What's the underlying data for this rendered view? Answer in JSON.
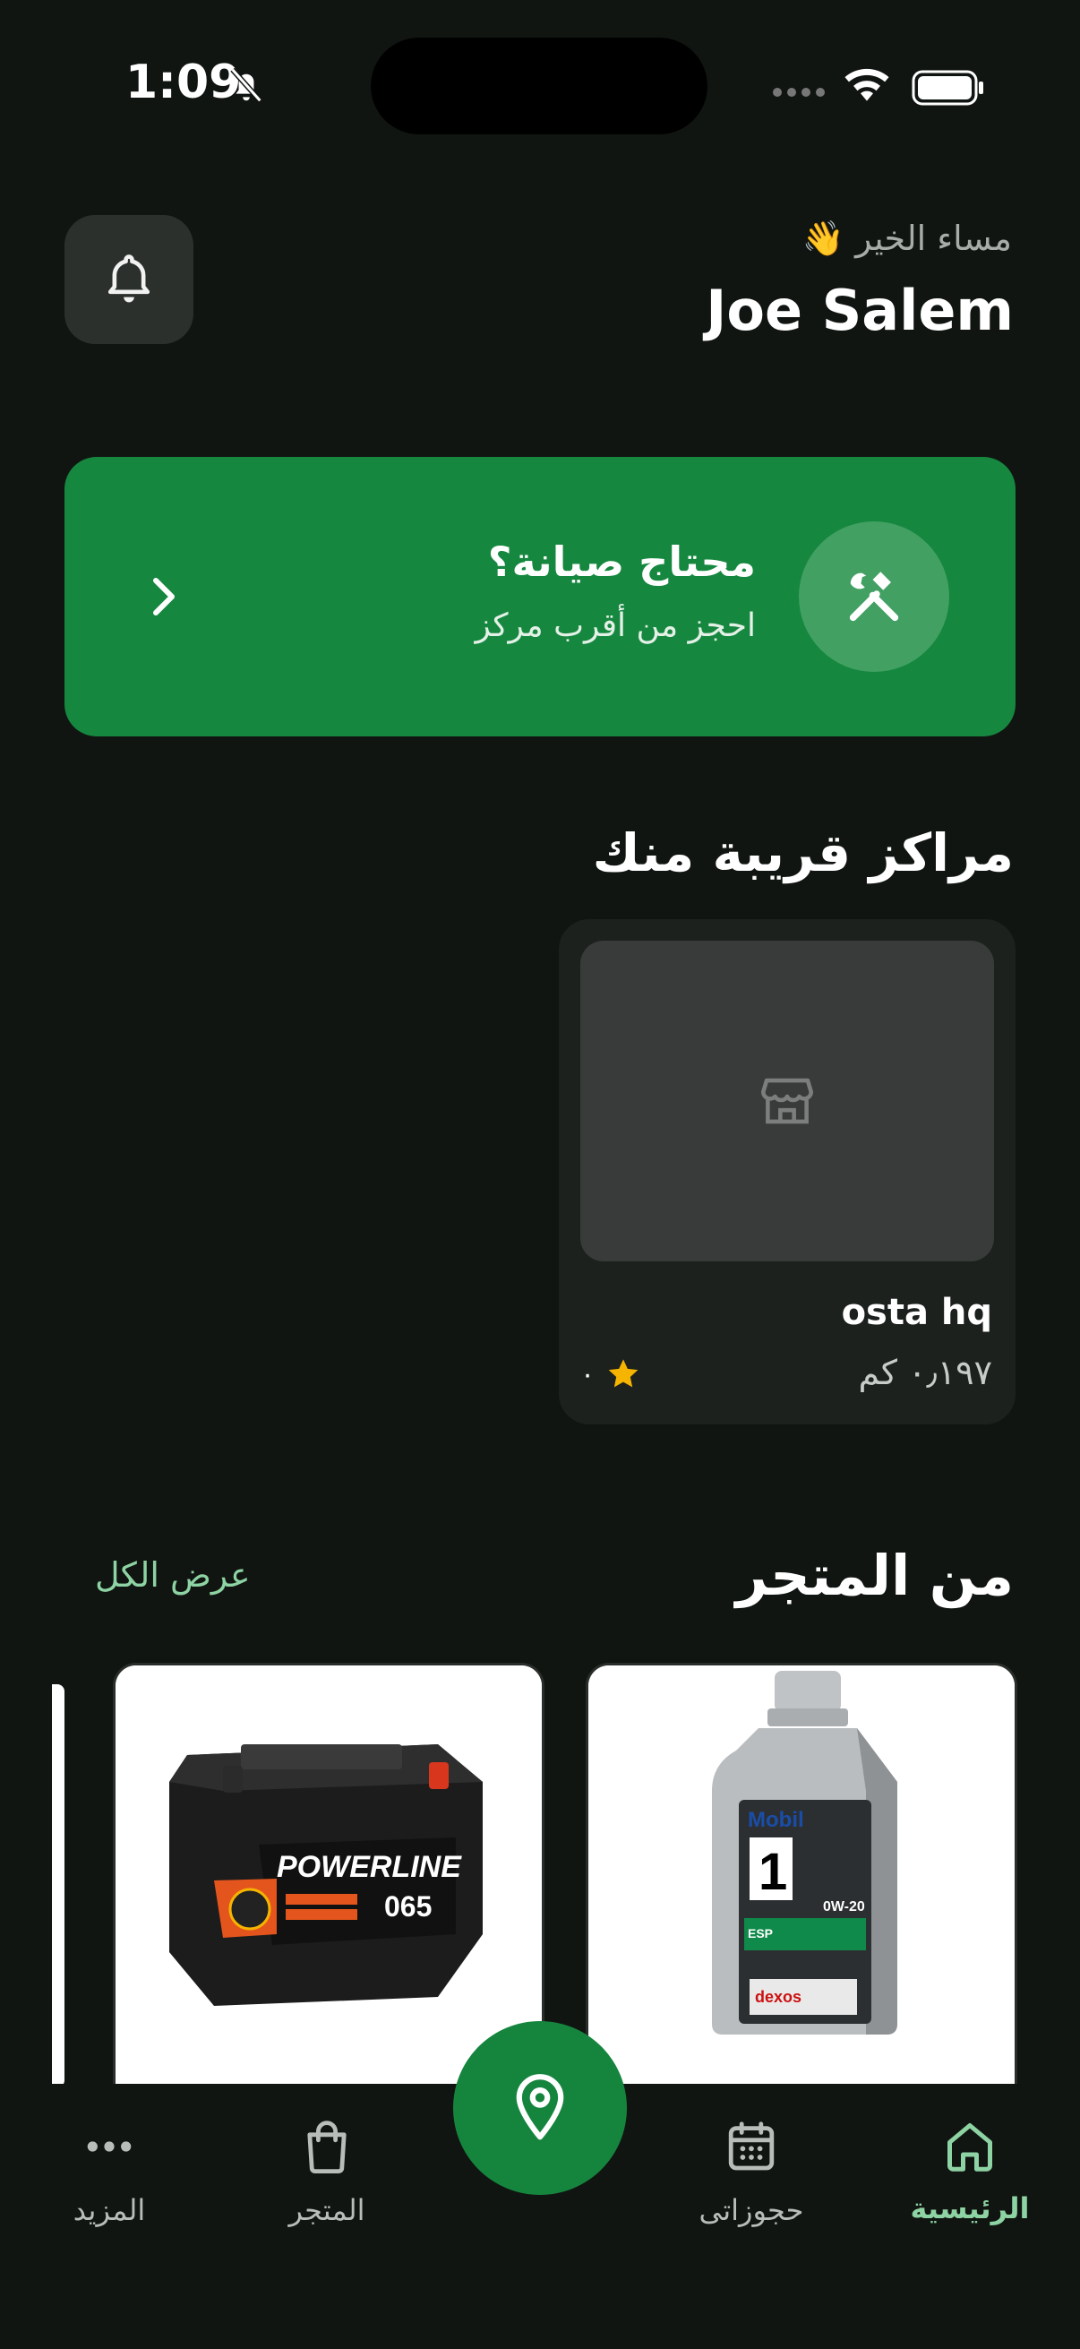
{
  "status_bar": {
    "time": "1:09"
  },
  "header": {
    "greeting": "مساء الخير 👋",
    "username": "Joe Salem"
  },
  "service_banner": {
    "title": "محتاج صيانة؟",
    "subtitle": "احجز من أقرب مركز"
  },
  "nearby": {
    "title": "مراكز قريبة منك",
    "centers": [
      {
        "name": "osta hq",
        "distance": "٠٫١٩٧ كم",
        "rating": "٠"
      }
    ]
  },
  "store": {
    "title": "من المتجر",
    "view_all": "عرض الكل",
    "products": [
      {
        "name": "Mobil oil"
      },
      {
        "name": "Bat"
      }
    ]
  },
  "bottom_nav": {
    "items": [
      {
        "label": "الرئيسية",
        "icon": "home-icon",
        "active": true
      },
      {
        "label": "حجوزاتى",
        "icon": "calendar-icon"
      },
      {
        "label": "المتجر",
        "icon": "shopping-bag-icon"
      },
      {
        "label": "المزيد",
        "icon": "more-dots-icon"
      }
    ],
    "fab_icon": "location-pin-icon"
  },
  "colors": {
    "background": "#111511",
    "accent_green": "#16873f",
    "active_tab": "#8dd3a3"
  }
}
